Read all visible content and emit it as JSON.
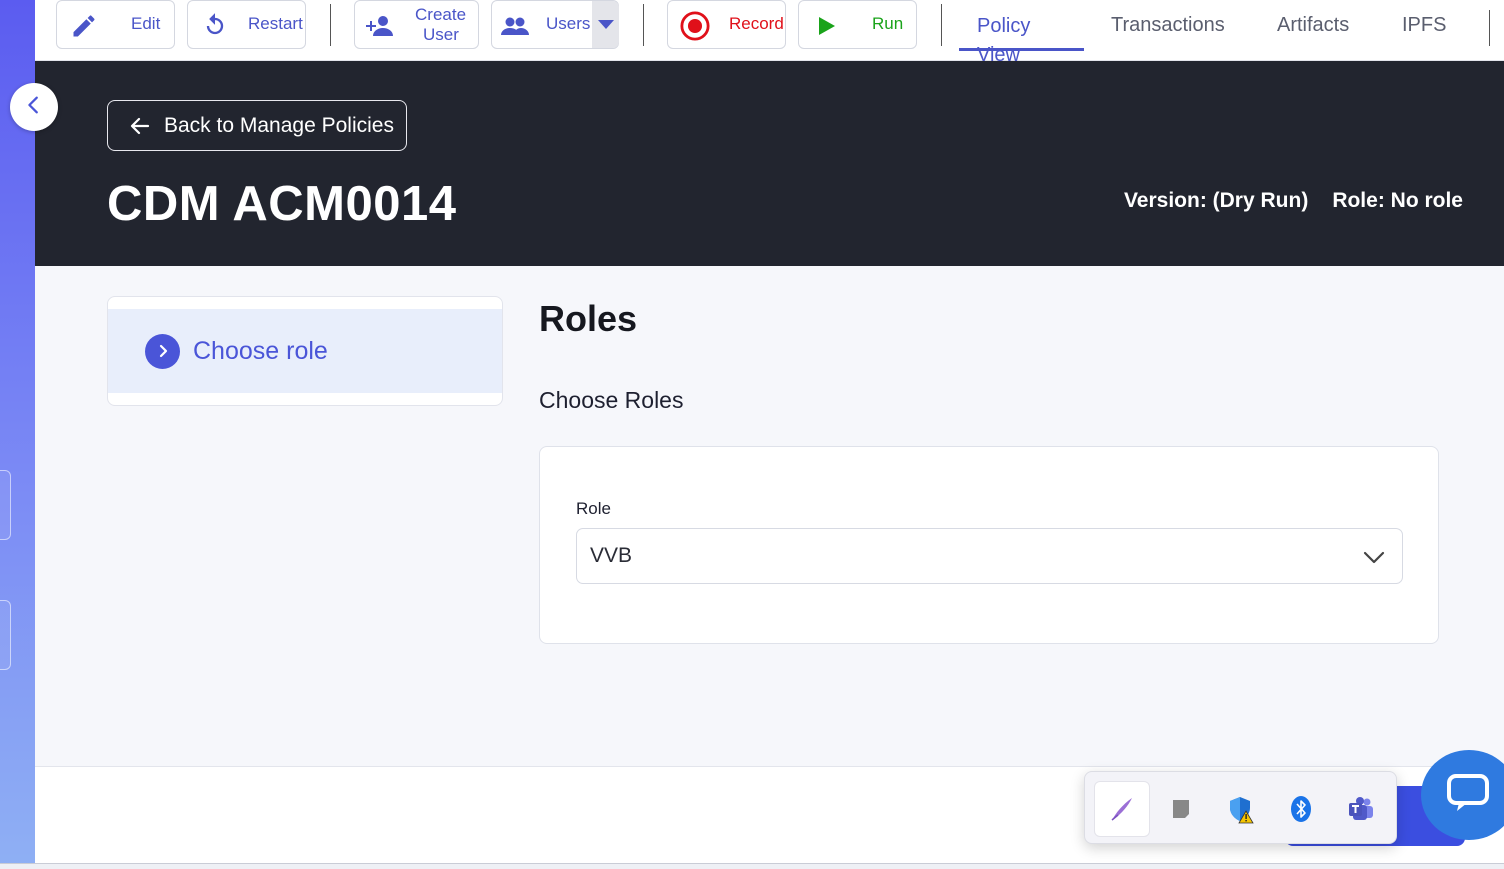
{
  "toolbar": {
    "edit_label": "Edit",
    "restart_label": "Restart",
    "create_user_label_1": "Create",
    "create_user_label_2": "User",
    "users_label": "Users",
    "record_label": "Record",
    "run_label": "Run"
  },
  "nav_tabs": [
    {
      "label": "Policy View",
      "active": true
    },
    {
      "label": "Transactions",
      "active": false
    },
    {
      "label": "Artifacts",
      "active": false
    },
    {
      "label": "IPFS",
      "active": false
    }
  ],
  "header": {
    "back_label": "Back to Manage Policies",
    "title": "CDM ACM0014",
    "version": "Version: (Dry Run)",
    "role": "Role: No role"
  },
  "steps": [
    {
      "label": "Choose role",
      "active": true
    }
  ],
  "main": {
    "title": "Roles",
    "subtitle": "Choose Roles",
    "role_field_label": "Role",
    "role_selected": "VVB"
  },
  "colors": {
    "accent": "#4a55c8",
    "header_bg": "#22252f",
    "record_red": "#e0101a",
    "run_green": "#1aa31a"
  },
  "icons": {
    "edit": "pencil-icon",
    "restart": "restart-icon",
    "create_user": "person-add-icon",
    "users": "users-group-icon",
    "record": "record-icon",
    "run": "play-icon",
    "back": "arrow-left-icon",
    "collapse": "chevron-left-icon",
    "step": "chevron-right-icon",
    "select": "chevron-down-icon",
    "tray": [
      "pen-icon",
      "note-icon",
      "shield-warning-icon",
      "bluetooth-icon",
      "teams-icon"
    ],
    "chat": "chat-icon"
  }
}
